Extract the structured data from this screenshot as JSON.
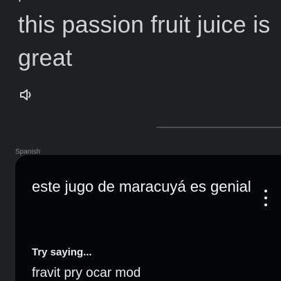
{
  "source": {
    "top_cut_text": "pas",
    "text": "this passion fruit juice is great",
    "speaker_icon": "speaker-icon"
  },
  "translation_section": {
    "label_cut": "Spanish",
    "text": "este jugo de maracuyá es genial",
    "menu_icon": "more-vert-icon",
    "try_saying_label": "Try saying...",
    "pronunciation": "fravit pry ocar mod"
  },
  "colors": {
    "background": "#1f2023",
    "card_background": "#040506",
    "source_text": "#cfd2d6",
    "translation_text": "#f1f2f4"
  }
}
